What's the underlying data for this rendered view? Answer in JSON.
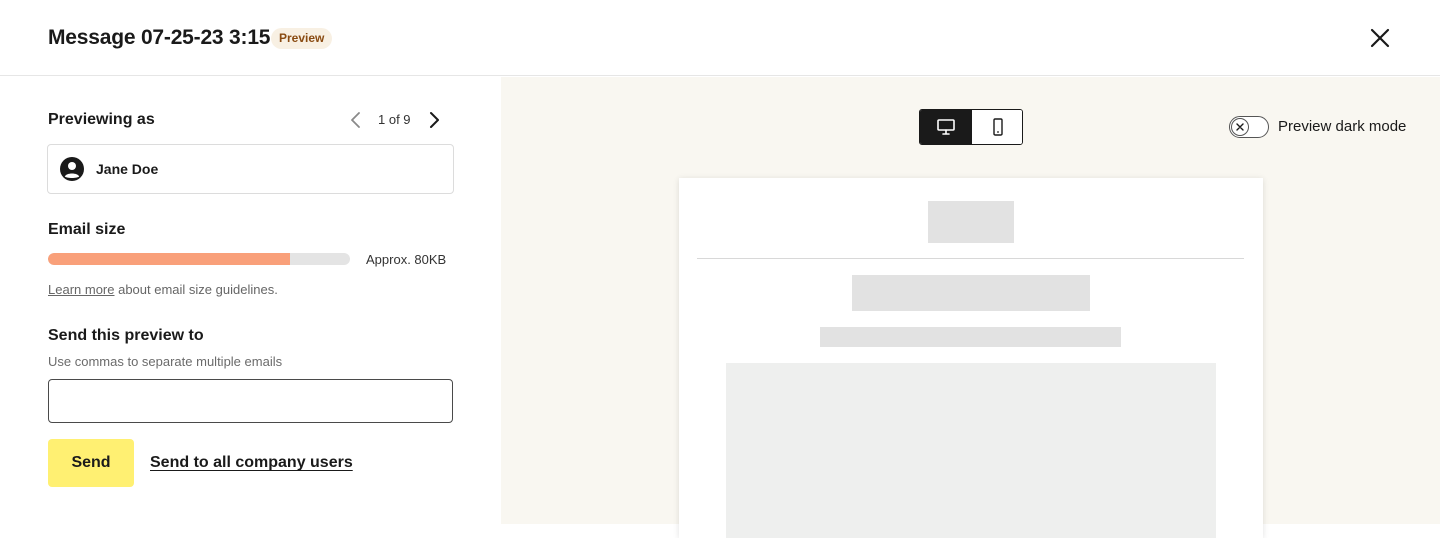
{
  "header": {
    "title": "Message 07-25-23 3:15",
    "badge": "Preview",
    "close_icon": "close-icon"
  },
  "preview_as": {
    "title": "Previewing as",
    "pager": "1 of 9",
    "user_name": "Jane Doe",
    "icons": [
      "chevron-left-icon",
      "chevron-right-icon",
      "user-avatar-icon"
    ]
  },
  "email_size": {
    "title": "Email size",
    "fill_fraction": 0.8,
    "label": "Approx. 80KB",
    "guideline_link": "Learn more",
    "guideline_text": " about email size guidelines.",
    "colors": {
      "fill": "#f9a07a",
      "track": "#e4e4e4"
    }
  },
  "send_preview": {
    "title": "Send this preview to",
    "hint": "Use commas to separate multiple emails",
    "input_value": "",
    "send_label": "Send",
    "send_all_label": "Send to all company users",
    "send_color": "#fff072"
  },
  "preview_pane": {
    "device_options": [
      "desktop-icon",
      "mobile-icon"
    ],
    "selected_device": "desktop",
    "dark_mode_label": "Preview dark mode",
    "dark_mode_on": false,
    "background": "#f9f7f1"
  }
}
